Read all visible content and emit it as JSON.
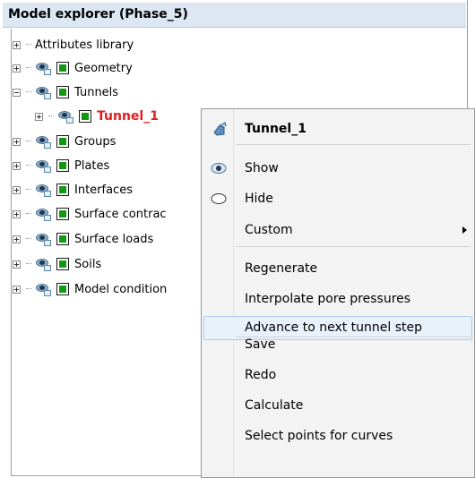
{
  "panel": {
    "title": "Model explorer (Phase_5)"
  },
  "tree": [
    {
      "label": "Attributes library",
      "expander": "plus"
    },
    {
      "label": "Geometry",
      "expander": "plus"
    },
    {
      "label": "Tunnels",
      "expander": "minus"
    },
    {
      "label": "Tunnel_1",
      "expander": "plus",
      "selected": true
    },
    {
      "label": "Groups",
      "expander": "plus"
    },
    {
      "label": "Plates",
      "expander": "plus"
    },
    {
      "label": "Interfaces",
      "expander": "plus"
    },
    {
      "label": "Surface contrac",
      "expander": "plus"
    },
    {
      "label": "Surface loads",
      "expander": "plus"
    },
    {
      "label": "Soils",
      "expander": "plus"
    },
    {
      "label": "Model condition",
      "expander": "plus"
    }
  ],
  "context_menu": {
    "header": "Tunnel_1",
    "show": "Show",
    "hide": "Hide",
    "custom": "Custom",
    "regenerate": "Regenerate",
    "interpolate": "Interpolate pore pressures",
    "advance": "Advance to next tunnel step",
    "save": "Save",
    "redo": "Redo",
    "calculate": "Calculate",
    "select_points": "Select points for curves"
  },
  "colors": {
    "selected_text": "#e02020",
    "highlight": "#e9f1fb",
    "checkbox_fill": "#119911"
  }
}
